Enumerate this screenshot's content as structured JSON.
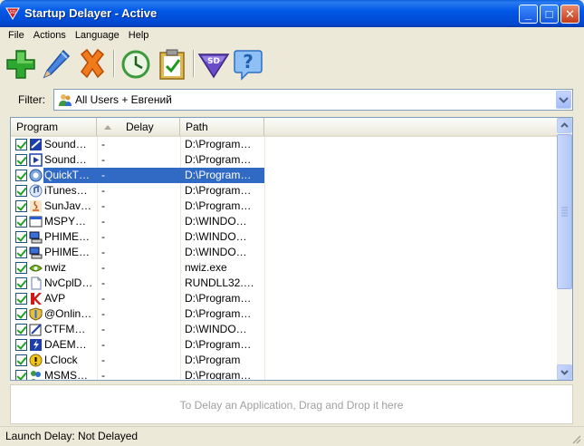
{
  "window": {
    "title": "Startup Delayer - Active",
    "buttons": {
      "minimize": "_",
      "maximize": "□",
      "close": "✕"
    }
  },
  "menu": [
    "File",
    "Actions",
    "Language",
    "Help"
  ],
  "toolbar": {
    "buttons": [
      {
        "name": "add",
        "icon": "plus-icon",
        "color": "#2ea82e"
      },
      {
        "name": "edit",
        "icon": "pencil-icon",
        "color": "#2f6fd6"
      },
      {
        "name": "remove",
        "icon": "x-icon",
        "color": "#e8620c"
      },
      {
        "name": "delay",
        "icon": "clock-icon",
        "color": "#3c9a3c"
      },
      {
        "name": "checklist",
        "icon": "clipboard-check-icon",
        "color": "#c79a2a"
      },
      {
        "name": "sd",
        "icon": "sd-shield-icon",
        "color": "#6a4cc8",
        "text": "SD"
      },
      {
        "name": "help",
        "icon": "question-icon",
        "color": "#4f90e0"
      }
    ]
  },
  "filter": {
    "label": "Filter:",
    "value": "All Users + Евгений"
  },
  "list": {
    "columns": [
      "Program",
      "Delay",
      "Path"
    ],
    "sorted_column": "Delay",
    "rows": [
      {
        "name": "Sound…",
        "delay": "-",
        "path": "D:\\Program…",
        "icon": "sound-icon",
        "checked": true
      },
      {
        "name": "Sound…",
        "delay": "-",
        "path": "D:\\Program…",
        "icon": "play-icon",
        "checked": true
      },
      {
        "name": "QuickT…",
        "delay": "-",
        "path": "D:\\Program…",
        "icon": "quicktime-icon",
        "checked": true,
        "selected": true
      },
      {
        "name": "iTunes…",
        "delay": "-",
        "path": "D:\\Program…",
        "icon": "itunes-icon",
        "checked": true
      },
      {
        "name": "SunJav…",
        "delay": "-",
        "path": "D:\\Program…",
        "icon": "java-icon",
        "checked": true
      },
      {
        "name": "MSPY…",
        "delay": "-",
        "path": "D:\\WINDO…",
        "icon": "window-icon",
        "checked": true
      },
      {
        "name": "PHIME…",
        "delay": "-",
        "path": "D:\\WINDO…",
        "icon": "computer-icon",
        "checked": true
      },
      {
        "name": "PHIME…",
        "delay": "-",
        "path": "D:\\WINDO…",
        "icon": "computer-icon",
        "checked": true
      },
      {
        "name": "nwiz",
        "delay": "-",
        "path": "nwiz.exe",
        "icon": "nvidia-icon",
        "checked": true
      },
      {
        "name": "NvCplD…",
        "delay": "-",
        "path": "RUNDLL32.…",
        "icon": "file-icon",
        "checked": true
      },
      {
        "name": "AVP",
        "delay": "-",
        "path": "D:\\Program…",
        "icon": "kaspersky-icon",
        "checked": true
      },
      {
        "name": "@Onlin…",
        "delay": "-",
        "path": "D:\\Program…",
        "icon": "shield-icon",
        "checked": true
      },
      {
        "name": "CTFM…",
        "delay": "-",
        "path": "D:\\WINDO…",
        "icon": "ctfmon-icon",
        "checked": true
      },
      {
        "name": "DAEM…",
        "delay": "-",
        "path": "D:\\Program…",
        "icon": "daemon-icon",
        "checked": true
      },
      {
        "name": "LClock",
        "delay": "-",
        "path": "D:\\Program",
        "icon": "warning-icon",
        "checked": true
      },
      {
        "name": "MSMS…",
        "delay": "-",
        "path": "D:\\Program…",
        "icon": "messenger-icon",
        "checked": true
      }
    ]
  },
  "drop_area": {
    "text": "To Delay an Application, Drag and Drop it here"
  },
  "status": {
    "text": "Launch Delay: Not Delayed"
  },
  "colors": {
    "selection": "#316ac5",
    "titlebar": "#0058e6"
  }
}
